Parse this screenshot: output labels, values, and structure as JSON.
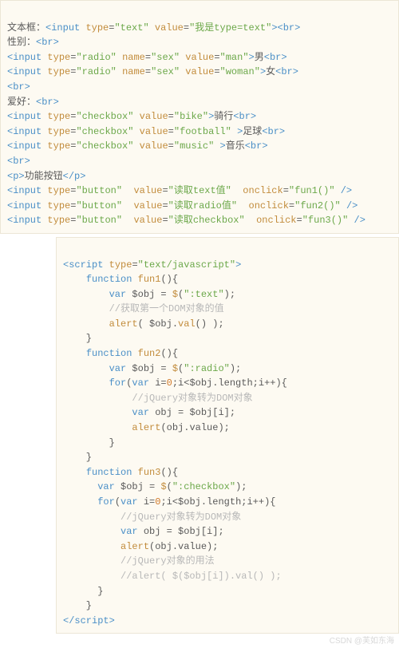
{
  "block1": {
    "l1": {
      "a": "文本框：",
      "b": "input",
      "c": "type",
      "d": "\"text\"",
      "e": "value",
      "f": "\"我是type=text\"",
      "g": "br"
    },
    "l2": {
      "a": "性别：",
      "b": "br"
    },
    "l3": {
      "a": "input",
      "b": "type",
      "c": "\"radio\"",
      "d": "name",
      "e": "\"sex\"",
      "f": "value",
      "g": "\"man\"",
      "h": "男",
      "i": "br"
    },
    "l4": {
      "a": "input",
      "b": "type",
      "c": "\"radio\"",
      "d": "name",
      "e": "\"sex\"",
      "f": "value",
      "g": "\"woman\"",
      "h": "女",
      "i": "br"
    },
    "l5": {
      "a": "br"
    },
    "l6": {
      "a": "爱好：",
      "b": "br"
    },
    "l7": {
      "a": "input",
      "b": "type",
      "c": "\"checkbox\"",
      "d": "value",
      "e": "\"bike\"",
      "f": "骑行",
      "g": "br"
    },
    "l8": {
      "a": "input",
      "b": "type",
      "c": "\"checkbox\"",
      "d": "value",
      "e": "\"football\"",
      "f": "足球",
      "g": "br"
    },
    "l9": {
      "a": "input",
      "b": "type",
      "c": "\"checkbox\"",
      "d": "value",
      "e": "\"music\"",
      "f": "音乐",
      "g": "br"
    },
    "l10": {
      "a": "br"
    },
    "l11": {
      "a": "p",
      "b": "功能按钮",
      "c": "p"
    },
    "l12": {
      "a": "input",
      "b": "type",
      "c": "\"button\"",
      "d": "value",
      "e": "\"读取text值\"",
      "f": "onclick",
      "g": "\"fun1()\""
    },
    "l13": {
      "a": "input",
      "b": "type",
      "c": "\"button\"",
      "d": "value",
      "e": "\"读取radio值\"",
      "f": "onclick",
      "g": "\"fun2()\""
    },
    "l14": {
      "a": "input",
      "b": "type",
      "c": "\"button\"",
      "d": "value",
      "e": "\"读取checkbox\"",
      "f": "onclick",
      "g": "\"fun3()\""
    }
  },
  "block2": {
    "s1": {
      "a": "script",
      "b": "type",
      "c": "\"text/javascript\""
    },
    "s2": {
      "a": "function",
      "b": "fun1"
    },
    "s3": {
      "a": "var",
      "b": "$obj = ",
      "c": "$",
      "d": "\":text\""
    },
    "s4": {
      "a": "//获取第一个DOM对象的值"
    },
    "s5": {
      "a": "alert",
      "b": "( $obj.",
      "c": "val",
      "d": "() );"
    },
    "s6": {
      "a": "function",
      "b": "fun2"
    },
    "s7": {
      "a": "var",
      "b": "$obj = ",
      "c": "$",
      "d": "\":radio\""
    },
    "s8": {
      "a": "for",
      "b": "var",
      "c": "i=",
      "d": "0",
      "e": ";i<$obj.length;i++){"
    },
    "s9": {
      "a": "//jQuery对象转为DOM对象"
    },
    "s10": {
      "a": "var",
      "b": "obj = $obj[i];"
    },
    "s11": {
      "a": "alert",
      "b": "(obj.value);"
    },
    "s12": {
      "a": "function",
      "b": "fun3"
    },
    "s13": {
      "a": "var",
      "b": "$obj = ",
      "c": "$",
      "d": "\":checkbox\""
    },
    "s14": {
      "a": "for",
      "b": "var",
      "c": "i=",
      "d": "0",
      "e": ";i<$obj.length;i++){"
    },
    "s15": {
      "a": "//jQuery对象转为DOM对象"
    },
    "s16": {
      "a": "var",
      "b": "obj = $obj[i];"
    },
    "s17": {
      "a": "alert",
      "b": "(obj.value);"
    },
    "s18": {
      "a": "//jQuery对象的用法"
    },
    "s19": {
      "a": "//alert( $($obj[i]).val() );"
    },
    "s20": {
      "a": "script"
    }
  },
  "watermark": "CSDN @芙如东海"
}
